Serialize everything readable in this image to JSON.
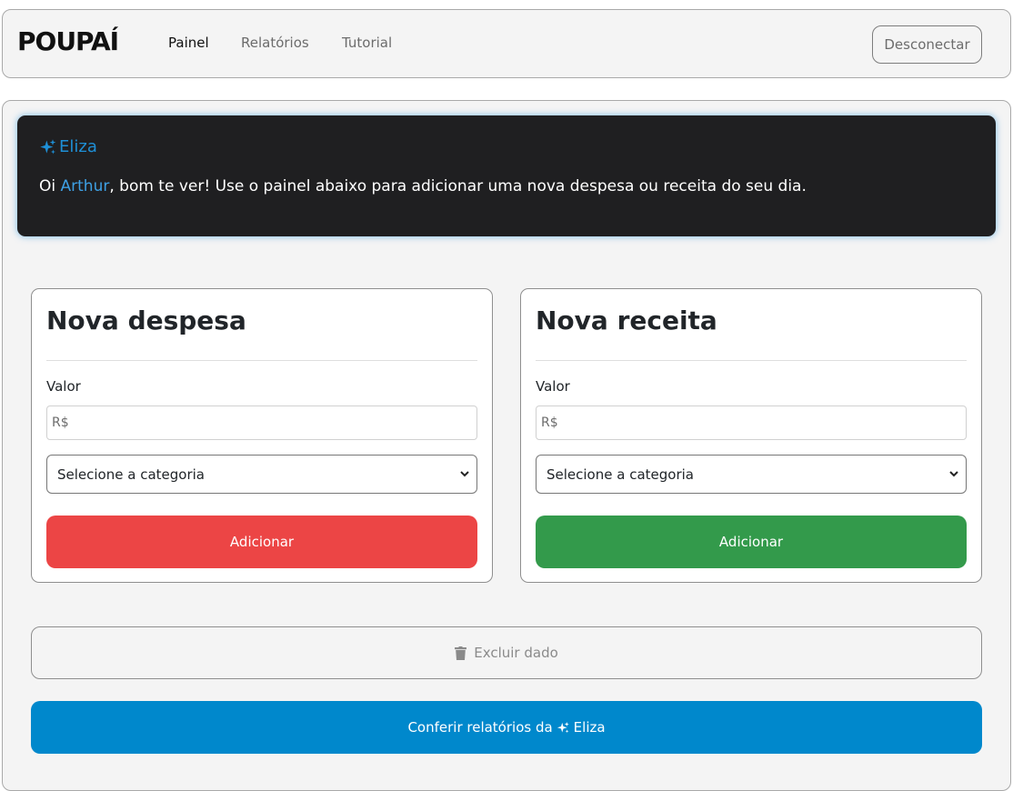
{
  "header": {
    "brand": "POUPAÍ",
    "nav": [
      {
        "label": "Painel",
        "active": true
      },
      {
        "label": "Relatórios",
        "active": false
      },
      {
        "label": "Tutorial",
        "active": false
      }
    ],
    "logout_label": "Desconectar"
  },
  "eliza": {
    "title": "Eliza",
    "greeting_prefix": "Oi ",
    "user_name": "Arthur",
    "greeting_suffix": ", bom te ver! Use o painel abaixo para adicionar uma nova despesa ou receita do seu dia.",
    "icon": "sparkle-icon",
    "accent_color": "#1e8fd6"
  },
  "expense_card": {
    "title": "Nova despesa",
    "value_label": "Valor",
    "value_placeholder": "R$",
    "category_selected": "Selecione a categoria",
    "add_label": "Adicionar",
    "button_color": "#ec4545"
  },
  "income_card": {
    "title": "Nova receita",
    "value_label": "Valor",
    "value_placeholder": "R$",
    "category_selected": "Selecione a categoria",
    "add_label": "Adicionar",
    "button_color": "#339a4b"
  },
  "actions": {
    "delete_label": "Excluir dado",
    "delete_icon": "trash-icon",
    "reports_prefix": "Conferir relatórios da",
    "reports_name": "Eliza",
    "reports_color": "#0088cc"
  }
}
